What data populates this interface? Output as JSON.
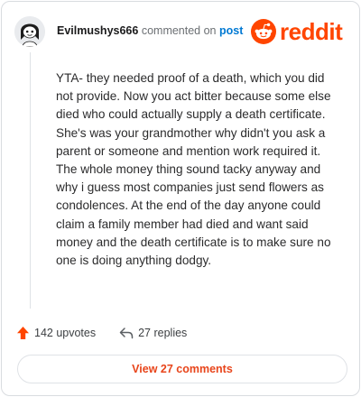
{
  "header": {
    "username": "Evilmushys666",
    "commented_on": "commented on",
    "post_link": "post",
    "brand": "reddit"
  },
  "comment": {
    "text": "YTA- they needed proof of a death, which you did not provide. Now you act bitter because some else died who could actually supply a death certificate. She's was your grandmother why didn't you ask a parent or someone and mention work required it. The whole money thing sound tacky anyway and why i guess most companies just send flowers as condolences. At the end of the day anyone could claim a family member had died and want said money and the death certificate is to make sure no one is doing anything dodgy."
  },
  "actions": {
    "upvotes": "142 upvotes",
    "replies": "27 replies",
    "view_comments": "View 27 comments"
  },
  "icons": {
    "avatar": "snoo-avatar-icon",
    "logo": "reddit-logo-icon",
    "upvote": "upvote-arrow-icon",
    "reply": "reply-arrow-icon"
  },
  "colors": {
    "brand": "#ff4500",
    "link": "#0079d3",
    "upvote": "#ff4500",
    "view_button_text": "#e8451b"
  }
}
